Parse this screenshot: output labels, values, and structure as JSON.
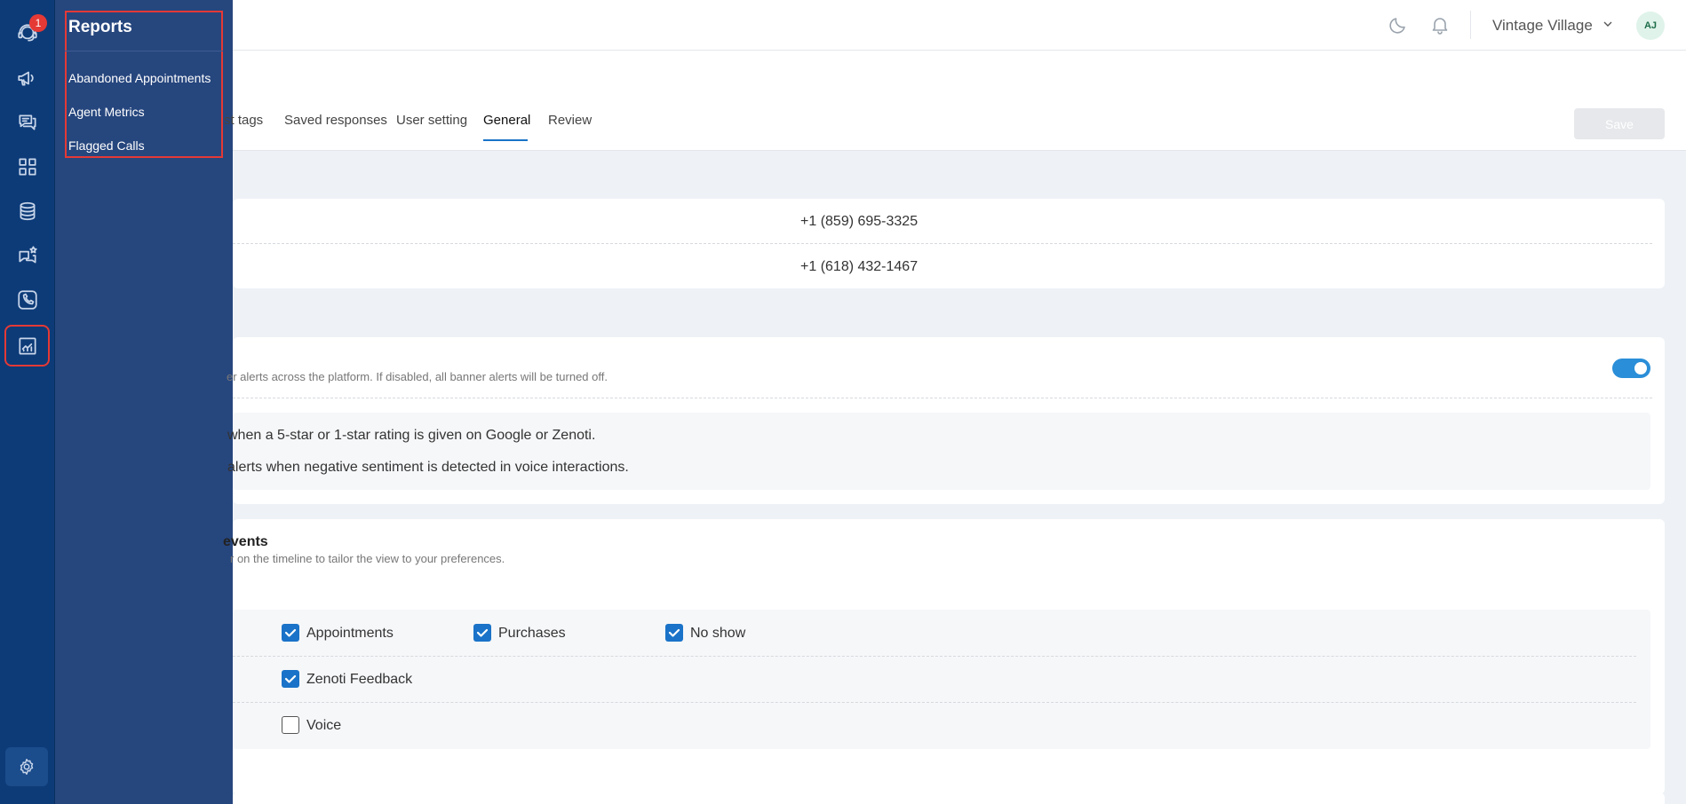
{
  "rail": {
    "notification_count": "1"
  },
  "flyout": {
    "title": "Reports",
    "items": [
      "Abandoned Appointments",
      "Agent Metrics",
      "Flagged Calls"
    ]
  },
  "header": {
    "org_name": "Vintage Village",
    "avatar_initials": "AJ"
  },
  "tabs": {
    "items": [
      "st tags",
      "Saved responses",
      "User setting",
      "General",
      "Review"
    ],
    "active": "General",
    "save_label": "Save"
  },
  "numbers": [
    "+1 (859) 695-3325",
    "+1 (618) 432-1467"
  ],
  "alerts": {
    "banner_desc": "er alerts across the platform. If disabled, all banner alerts will be turned off.",
    "banner_enabled": true,
    "rating_alert": "when a 5-star or 1-star rating is given on Google or Zenoti.",
    "sentiment_alert": "alerts when negative sentiment is detected in voice interactions."
  },
  "timeline": {
    "title": "events",
    "desc": "r on the timeline to tailor the view to your preferences.",
    "checkboxes": [
      {
        "label": "Appointments",
        "checked": true
      },
      {
        "label": "Purchases",
        "checked": true
      },
      {
        "label": "No show",
        "checked": true
      },
      {
        "label": "Zenoti Feedback",
        "checked": true
      },
      {
        "label": "Voice",
        "checked": false
      }
    ]
  },
  "icons": [
    "support-agent-icon",
    "megaphone-icon",
    "chat-bubbles-icon",
    "dashboard-icon",
    "database-icon",
    "chat-star-icon",
    "phone-icon",
    "reports-icon",
    "settings-icon",
    "moon-icon",
    "bell-icon",
    "chevron-down-icon",
    "check-icon"
  ]
}
